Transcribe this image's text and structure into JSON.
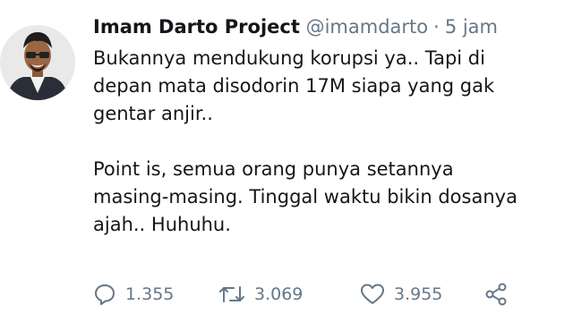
{
  "tweet": {
    "display_name": "Imam Darto Project",
    "handle": "@imamdarto",
    "separator": "·",
    "timestamp": "5 jam",
    "lines": [
      "Bukannya mendukung korupsi ya.. Tapi di",
      "depan mata disodorin 17M siapa yang gak",
      "gentar anjir..",
      "Point is, semua orang punya setannya",
      "masing-masing. Tinggal waktu bikin dosanya",
      "ajah.. Huhuhu."
    ],
    "actions": {
      "reply": {
        "icon": "reply-icon",
        "count": "1.355"
      },
      "retweet": {
        "icon": "retweet-icon",
        "count": "3.069"
      },
      "like": {
        "icon": "heart-icon",
        "count": "3.955"
      },
      "share": {
        "icon": "share-icon"
      }
    }
  },
  "colors": {
    "text": "#14171a",
    "secondary": "#657786",
    "background": "#ffffff"
  }
}
